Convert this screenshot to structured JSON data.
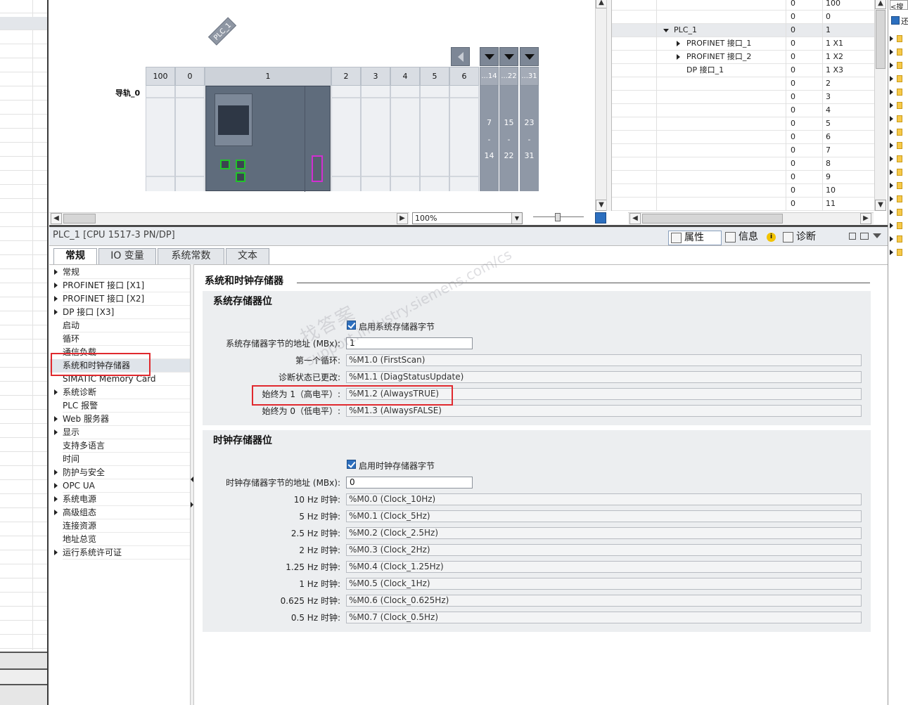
{
  "device_view": {
    "plc_tag": "PLC_1",
    "rail_label": "导轨_0",
    "slots": [
      "100",
      "0",
      "1",
      "2",
      "3",
      "4",
      "5",
      "6"
    ],
    "expansion_headers": [
      "...14",
      "...22",
      "...31"
    ],
    "expansion_columns": [
      {
        "top": "7",
        "mid": "-",
        "bottom": "14"
      },
      {
        "top": "15",
        "mid": "-",
        "bottom": "22"
      },
      {
        "top": "23",
        "mid": "-",
        "bottom": "31"
      }
    ],
    "zoom": "100%"
  },
  "overview": {
    "rows": [
      {
        "name": "",
        "rack": "0",
        "slot": "100",
        "expand": ""
      },
      {
        "name": "",
        "rack": "0",
        "slot": "0",
        "expand": ""
      },
      {
        "name": "PLC_1",
        "rack": "0",
        "slot": "1",
        "expand": "down"
      },
      {
        "name": "PROFINET 接口_1",
        "rack": "0",
        "slot": "1 X1",
        "expand": "right"
      },
      {
        "name": "PROFINET 接口_2",
        "rack": "0",
        "slot": "1 X2",
        "expand": "right"
      },
      {
        "name": "DP 接口_1",
        "rack": "0",
        "slot": "1 X3",
        "expand": ""
      },
      {
        "name": "",
        "rack": "0",
        "slot": "2",
        "expand": ""
      },
      {
        "name": "",
        "rack": "0",
        "slot": "3",
        "expand": ""
      },
      {
        "name": "",
        "rack": "0",
        "slot": "4",
        "expand": ""
      },
      {
        "name": "",
        "rack": "0",
        "slot": "5",
        "expand": ""
      },
      {
        "name": "",
        "rack": "0",
        "slot": "6",
        "expand": ""
      },
      {
        "name": "",
        "rack": "0",
        "slot": "7",
        "expand": ""
      },
      {
        "name": "",
        "rack": "0",
        "slot": "8",
        "expand": ""
      },
      {
        "name": "",
        "rack": "0",
        "slot": "9",
        "expand": ""
      },
      {
        "name": "",
        "rack": "0",
        "slot": "10",
        "expand": ""
      },
      {
        "name": "",
        "rack": "0",
        "slot": "11",
        "expand": ""
      }
    ]
  },
  "far_right": {
    "search": "<搜",
    "check_label": "还"
  },
  "inspector": {
    "title": "PLC_1 [CPU 1517-3 PN/DP]",
    "tabs": {
      "properties": "属性",
      "info": "信息",
      "diagnostics": "诊断"
    },
    "sub_tabs": [
      "常规",
      "IO 变量",
      "系统常数",
      "文本"
    ]
  },
  "nav": [
    {
      "label": "常规",
      "arrow": true
    },
    {
      "label": "PROFINET 接口 [X1]",
      "arrow": true
    },
    {
      "label": "PROFINET 接口 [X2]",
      "arrow": true
    },
    {
      "label": "DP 接口 [X3]",
      "arrow": true
    },
    {
      "label": "启动",
      "arrow": false
    },
    {
      "label": "循环",
      "arrow": false
    },
    {
      "label": "通信负载",
      "arrow": false
    },
    {
      "label": "系统和时钟存储器",
      "arrow": false
    },
    {
      "label": "SIMATIC Memory Card",
      "arrow": false
    },
    {
      "label": "系统诊断",
      "arrow": true
    },
    {
      "label": "PLC 报警",
      "arrow": false
    },
    {
      "label": "Web 服务器",
      "arrow": true
    },
    {
      "label": "显示",
      "arrow": true
    },
    {
      "label": "支持多语言",
      "arrow": false
    },
    {
      "label": "时间",
      "arrow": false
    },
    {
      "label": "防护与安全",
      "arrow": true
    },
    {
      "label": "OPC UA",
      "arrow": true
    },
    {
      "label": "系统电源",
      "arrow": true
    },
    {
      "label": "高级组态",
      "arrow": true
    },
    {
      "label": "连接资源",
      "arrow": false
    },
    {
      "label": "地址总览",
      "arrow": false
    },
    {
      "label": "运行系统许可证",
      "arrow": true
    }
  ],
  "content": {
    "section_title": "系统和时钟存储器",
    "system": {
      "title": "系统存储器位",
      "enable_label": "启用系统存储器字节",
      "address_label": "系统存储器字节的地址 (MBx):",
      "address_value": "1",
      "bits": [
        {
          "label": "第一个循环:",
          "value": "%M1.0 (FirstScan)"
        },
        {
          "label": "诊断状态已更改:",
          "value": "%M1.1 (DiagStatusUpdate)"
        },
        {
          "label": "始终为 1（高电平）:",
          "value": "%M1.2 (AlwaysTRUE)"
        },
        {
          "label": "始终为 0（低电平）:",
          "value": "%M1.3 (AlwaysFALSE)"
        }
      ]
    },
    "clock": {
      "title": "时钟存储器位",
      "enable_label": "启用时钟存储器字节",
      "address_label": "时钟存储器字节的地址 (MBx):",
      "address_value": "0",
      "bits": [
        {
          "label": "10 Hz 时钟:",
          "value": "%M0.0 (Clock_10Hz)"
        },
        {
          "label": "5 Hz 时钟:",
          "value": "%M0.1 (Clock_5Hz)"
        },
        {
          "label": "2.5 Hz 时钟:",
          "value": "%M0.2 (Clock_2.5Hz)"
        },
        {
          "label": "2 Hz 时钟:",
          "value": "%M0.3 (Clock_2Hz)"
        },
        {
          "label": "1.25 Hz 时钟:",
          "value": "%M0.4 (Clock_1.25Hz)"
        },
        {
          "label": "1 Hz 时钟:",
          "value": "%M0.5 (Clock_1Hz)"
        },
        {
          "label": "0.625 Hz 时钟:",
          "value": "%M0.6 (Clock_0.625Hz)"
        },
        {
          "label": "0.5 Hz 时钟:",
          "value": "%M0.7 (Clock_0.5Hz)"
        }
      ]
    }
  },
  "watermark": {
    "line1": "找答案",
    "line2": "support.industry.siemens.com/cs"
  },
  "colors": {
    "highlight_red": "#e0292e",
    "port_green": "#21c42a",
    "port_magenta": "#d12fd1",
    "checkbox_blue": "#2c6fbf"
  }
}
